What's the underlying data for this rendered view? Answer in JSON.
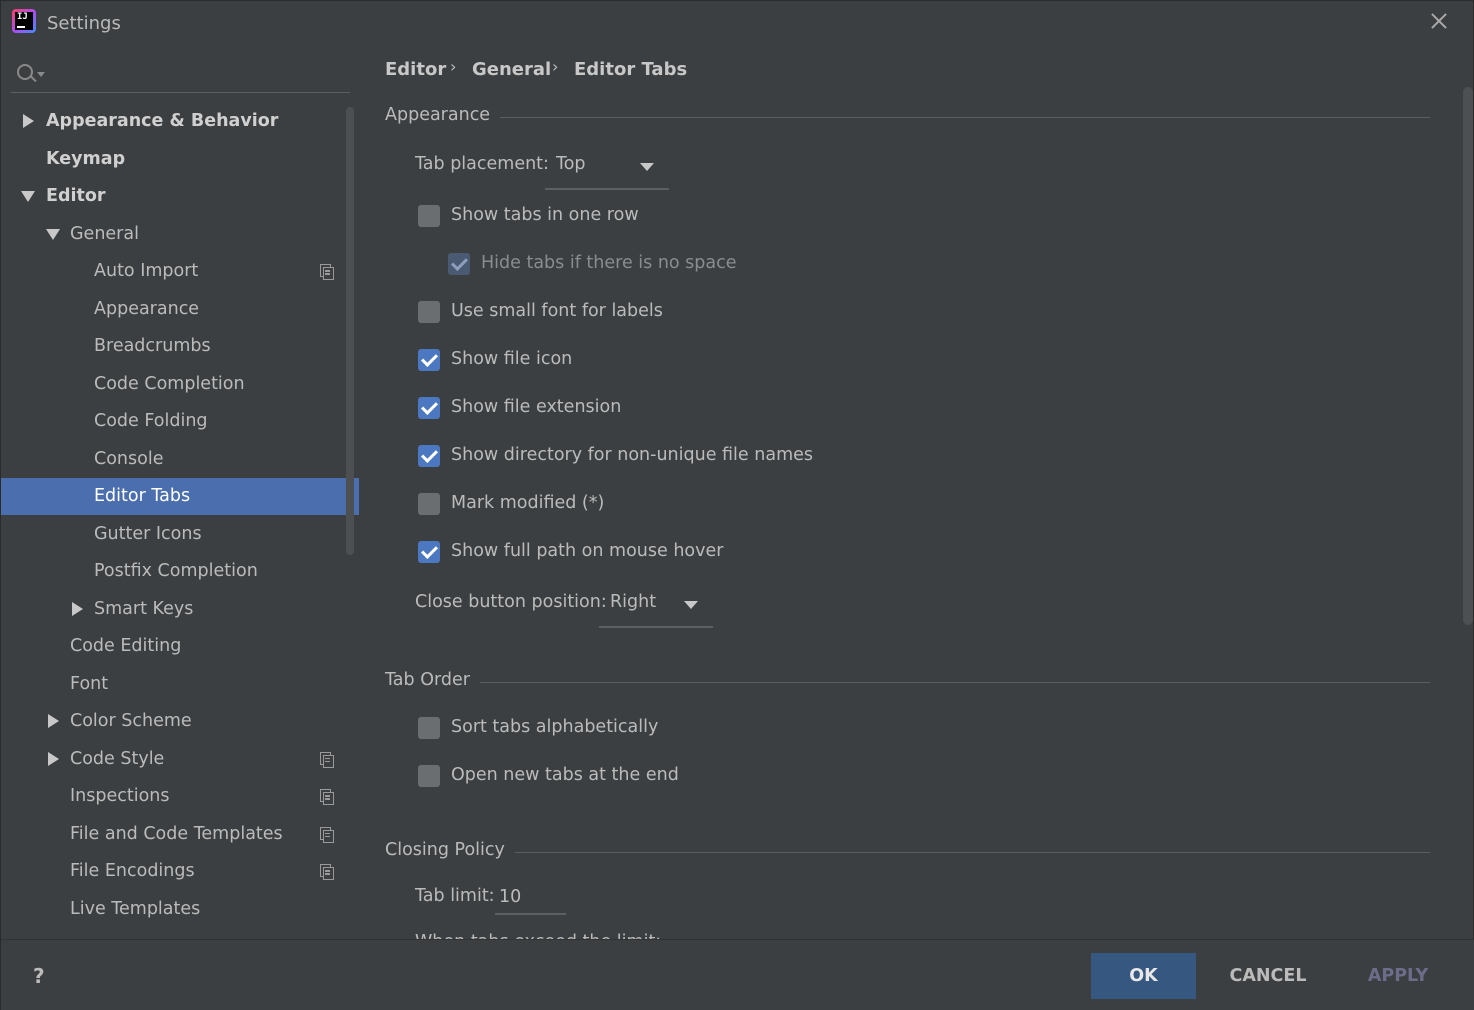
{
  "window": {
    "title": "Settings"
  },
  "search": {
    "placeholder": "",
    "value": ""
  },
  "sidebar": {
    "items": [
      {
        "label": "Appearance & Behavior",
        "expander": "collapsed",
        "bold": true
      },
      {
        "label": "Keymap",
        "expander": "none",
        "bold": true
      },
      {
        "label": "Editor",
        "expander": "expanded",
        "bold": true
      },
      {
        "label": "General",
        "expander": "expanded"
      },
      {
        "label": "Auto Import",
        "icon": "copy-icon"
      },
      {
        "label": "Appearance"
      },
      {
        "label": "Breadcrumbs"
      },
      {
        "label": "Code Completion"
      },
      {
        "label": "Code Folding"
      },
      {
        "label": "Console"
      },
      {
        "label": "Editor Tabs",
        "selected": true
      },
      {
        "label": "Gutter Icons"
      },
      {
        "label": "Postfix Completion"
      },
      {
        "label": "Smart Keys",
        "expander": "collapsed"
      },
      {
        "label": "Code Editing"
      },
      {
        "label": "Font"
      },
      {
        "label": "Color Scheme",
        "expander": "collapsed"
      },
      {
        "label": "Code Style",
        "expander": "collapsed",
        "icon": "copy-icon"
      },
      {
        "label": "Inspections",
        "icon": "copy-icon"
      },
      {
        "label": "File and Code Templates",
        "icon": "copy-icon"
      },
      {
        "label": "File Encodings",
        "icon": "copy-icon"
      },
      {
        "label": "Live Templates"
      }
    ]
  },
  "breadcrumb": [
    "Editor",
    "General",
    "Editor Tabs"
  ],
  "breadcrumb_separator": "›",
  "sections": {
    "appearance": {
      "title": "Appearance",
      "tab_placement_label": "Tab placement:",
      "tab_placement_value": "Top",
      "checkboxes": [
        {
          "label": "Show tabs in one row",
          "checked": false
        },
        {
          "label": "Hide tabs if there is no space",
          "checked": true,
          "disabled": true
        },
        {
          "label": "Use small font for labels",
          "checked": false
        },
        {
          "label": "Show file icon",
          "checked": true
        },
        {
          "label": "Show file extension",
          "checked": true
        },
        {
          "label": "Show directory for non-unique file names",
          "checked": true
        },
        {
          "label": "Mark modified (*)",
          "checked": false
        },
        {
          "label": "Show full path on mouse hover",
          "checked": true
        }
      ],
      "close_button_label": "Close button position:",
      "close_button_value": "Right"
    },
    "tab_order": {
      "title": "Tab Order",
      "checkboxes": [
        {
          "label": "Sort tabs alphabetically",
          "checked": false
        },
        {
          "label": "Open new tabs at the end",
          "checked": false
        }
      ]
    },
    "closing_policy": {
      "title": "Closing Policy",
      "tab_limit_label": "Tab limit:",
      "tab_limit_value": "10",
      "cutoff_text": "When tabs exceed the limit:"
    }
  },
  "buttons": {
    "help": "?",
    "ok": "OK",
    "cancel": "CANCEL",
    "apply": "APPLY"
  },
  "colors": {
    "background": "#3c3f41",
    "selection": "#4b6eaf",
    "checkbox_checked": "#4c78c2",
    "ok_button": "#365880"
  }
}
